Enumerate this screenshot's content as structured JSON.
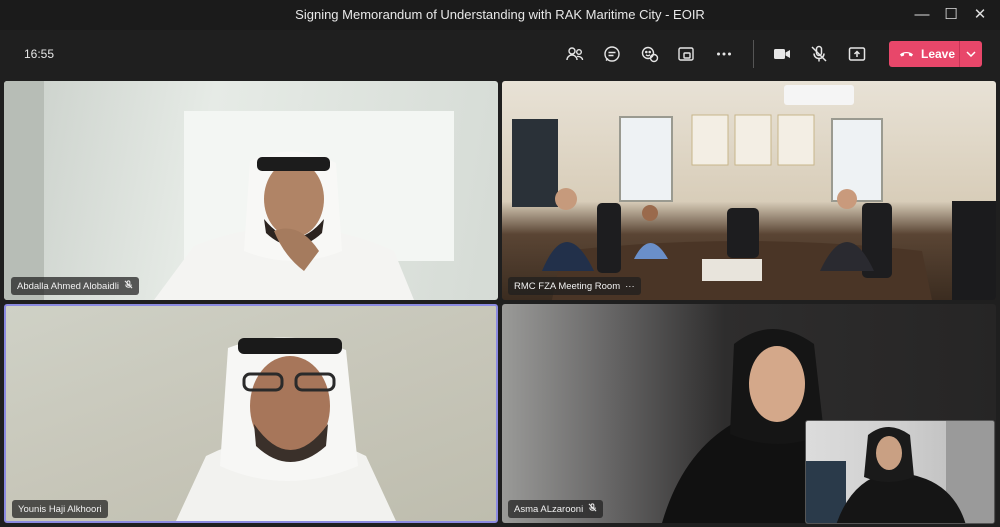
{
  "window": {
    "title": "Signing Memorandum of Understanding with RAK Maritime City - EOIR",
    "controls": {
      "minimize": "—",
      "maximize": "☐",
      "close": "✕"
    }
  },
  "toolbar": {
    "time": "16:55",
    "icons": [
      "people-icon",
      "chat-icon",
      "react-icon",
      "share-tray-icon",
      "more-icon",
      "camera-icon",
      "mic-off-icon",
      "share-icon"
    ],
    "leave_label": "Leave",
    "leave_color": "#e8476a"
  },
  "participants": [
    {
      "name": "Abdalla Ahmed Alobaidli",
      "muted": true
    },
    {
      "name": "RMC FZA Meeting Room",
      "more": "···"
    },
    {
      "name": "Younis Haji Alkhoori",
      "muted": false,
      "active_speaker": true
    },
    {
      "name": "Asma ALzarooni",
      "muted": true
    }
  ],
  "colors": {
    "active_border": "#8b8ae0",
    "background": "#1f1f1f"
  }
}
